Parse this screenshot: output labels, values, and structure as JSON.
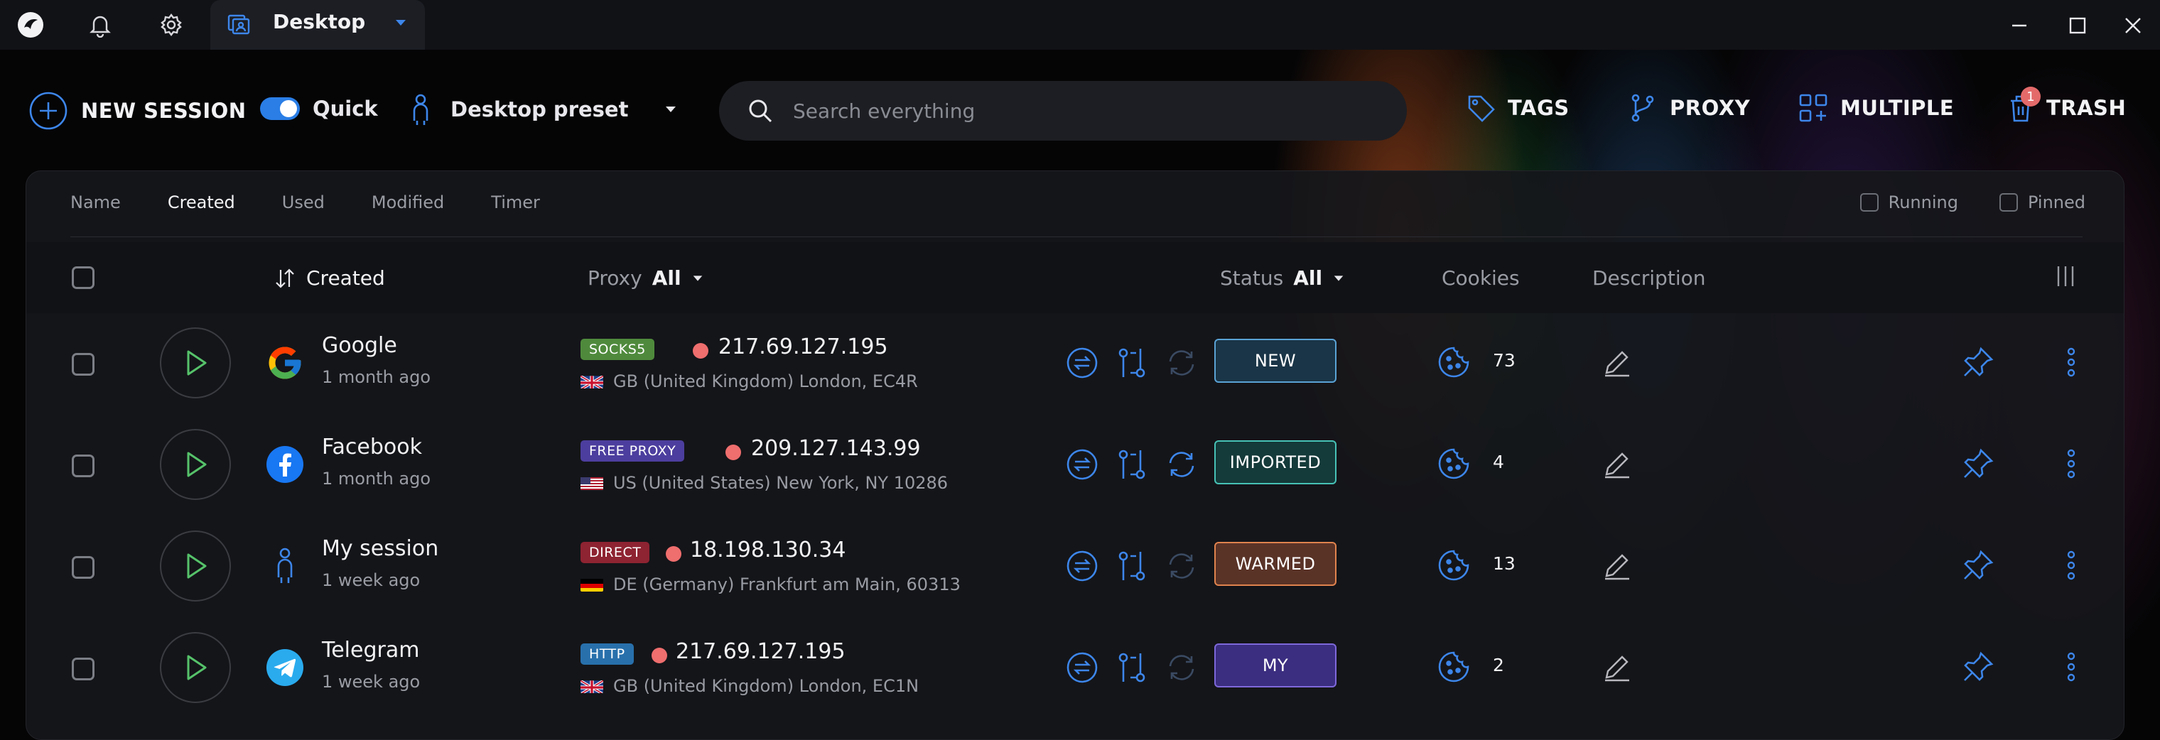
{
  "titlebar": {
    "active_tab": "Desktop"
  },
  "toolbar": {
    "new_session": "NEW SESSION",
    "quick": "Quick",
    "preset": "Desktop preset",
    "search_placeholder": "Search everything",
    "tags": "TAGS",
    "proxy": "PROXY",
    "multiple": "MULTIPLE",
    "trash": "TRASH",
    "trash_count": "1"
  },
  "sort_tabs": [
    "Name",
    "Created",
    "Used",
    "Modified",
    "Timer"
  ],
  "sort_active": "Created",
  "filters": {
    "running": "Running",
    "pinned": "Pinned"
  },
  "table_header": {
    "created": "Created",
    "proxy": "Proxy",
    "proxy_filter": "All",
    "status": "Status",
    "status_filter": "All",
    "cookies": "Cookies",
    "description": "Description"
  },
  "rows": [
    {
      "name": "Google",
      "time": "1 month ago",
      "proxy_type": "SOCKS5",
      "proxy_type_color": "#4f8a3c",
      "ip": "217.69.127.195",
      "location": "GB (United Kingdom) London, EC4R",
      "status": "NEW",
      "status_color": "#5aa3d6",
      "status_bg": "#1a3547",
      "cookies": "73"
    },
    {
      "name": "Facebook",
      "time": "1 month ago",
      "proxy_type": "FREE PROXY",
      "proxy_type_color": "#4c3e9e",
      "ip": "209.127.143.99",
      "location": "US (United States) New York, NY 10286",
      "status": "IMPORTED",
      "status_color": "#47c2b6",
      "status_bg": "#143a39",
      "cookies": "4"
    },
    {
      "name": "My session",
      "time": "1 week ago",
      "proxy_type": "DIRECT",
      "proxy_type_color": "#8e2331",
      "ip": "18.198.130.34",
      "location": "DE (Germany) Frankfurt am Main, 60313",
      "status": "WARMED",
      "status_color": "#e0834e",
      "status_bg": "#5a3327",
      "cookies": "13"
    },
    {
      "name": "Telegram",
      "time": "1 week ago",
      "proxy_type": "HTTP",
      "proxy_type_color": "#2870ac",
      "ip": "217.69.127.195",
      "location": "GB (United Kingdom) London, EC1N",
      "status": "MY",
      "status_color": "#7e68da",
      "status_bg": "#3b2e80",
      "cookies": "2"
    }
  ],
  "colors": {
    "accent": "#2a7ee6",
    "icon_blue": "#3d86ea"
  }
}
